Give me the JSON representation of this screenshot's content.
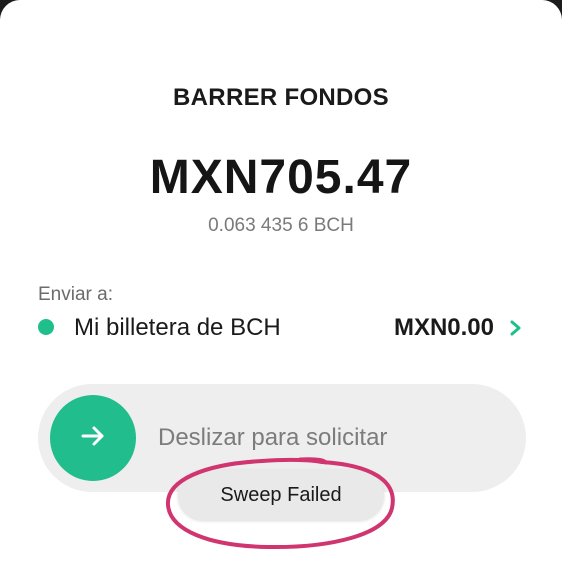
{
  "sheet": {
    "title": "BARRER FONDOS"
  },
  "balance": {
    "fiat_amount": "MXN705.47",
    "crypto_amount": "0.063 435 6 BCH"
  },
  "destination": {
    "label": "Enviar a:",
    "wallet_name": "Mi billetera de BCH",
    "wallet_balance": "MXN0.00",
    "status_color": "#1fbf8b",
    "chevron_icon": "chevron-right-icon"
  },
  "slider": {
    "label": "Deslizar para solicitar",
    "knob_icon": "arrow-right-icon",
    "accent": "#22bd8c"
  },
  "toast": {
    "message": "Sweep Failed"
  },
  "annotation": {
    "color": "#d0356f"
  }
}
